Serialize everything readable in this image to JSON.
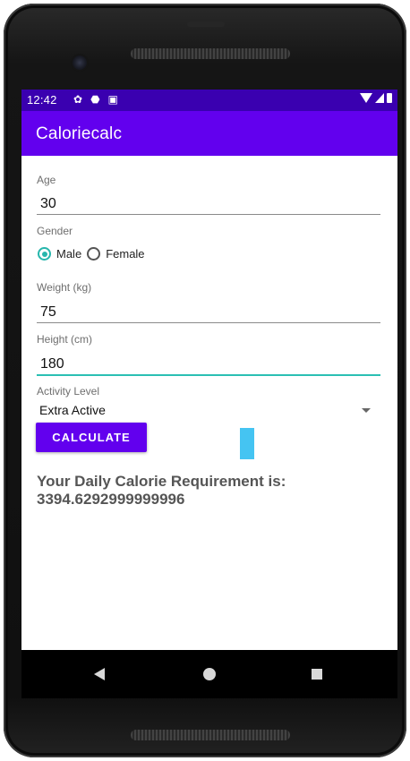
{
  "status_bar": {
    "time": "12:42",
    "left_icons": [
      "gear-icon",
      "shield-icon",
      "sd-card-icon"
    ],
    "right_icons": [
      "wifi-icon",
      "signal-icon",
      "battery-icon"
    ],
    "left_icon_glyphs": [
      "✿",
      "⬣",
      "▣"
    ]
  },
  "app_bar": {
    "title": "Caloriecalc",
    "color": "#6200ee",
    "status_color": "#3a00b0"
  },
  "form": {
    "age": {
      "label": "Age",
      "value": "30"
    },
    "gender": {
      "label": "Gender",
      "options": [
        {
          "label": "Male",
          "checked": true
        },
        {
          "label": "Female",
          "checked": false
        }
      ]
    },
    "weight": {
      "label": "Weight (kg)",
      "value": "75"
    },
    "height": {
      "label": "Height (cm)",
      "value": "180"
    },
    "activity": {
      "label": "Activity Level",
      "selected": "Extra Active"
    },
    "calculate_label": "CALCULATE"
  },
  "result": {
    "text": "Your Daily Calorie Requirement is: 3394.6292999999996"
  },
  "accent_color": "#2bbfb3",
  "nav_bar": {
    "buttons": [
      "back-icon",
      "home-icon",
      "recents-icon"
    ]
  }
}
